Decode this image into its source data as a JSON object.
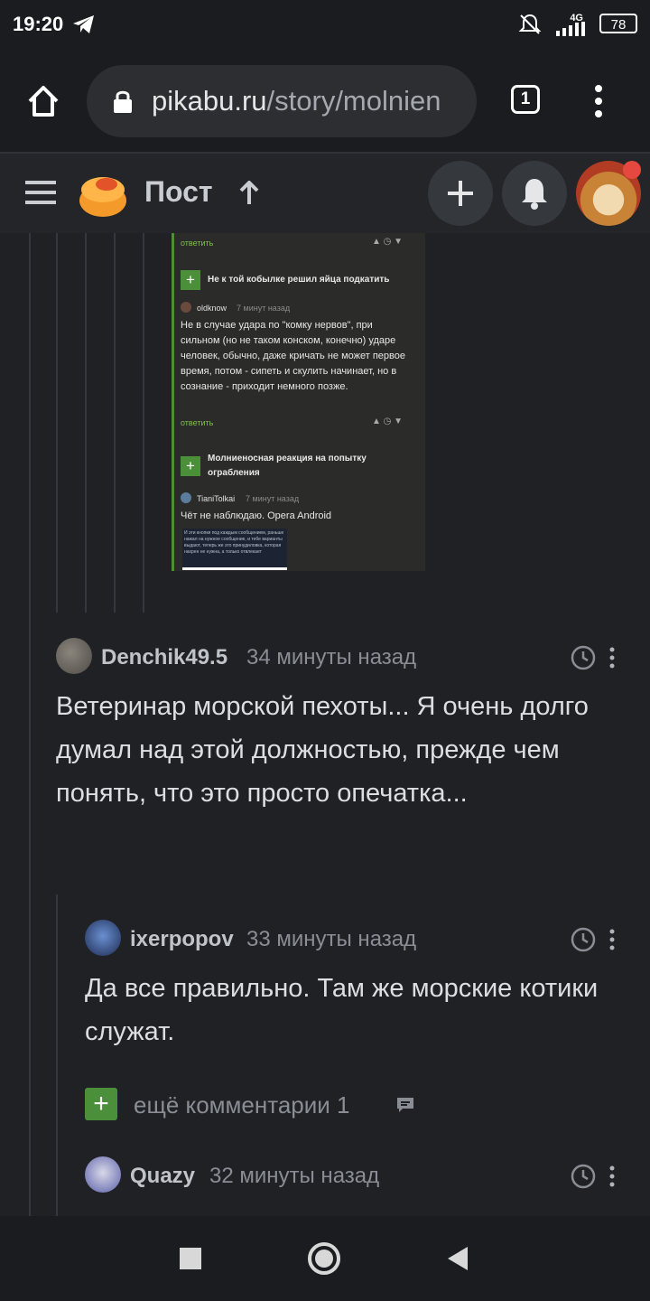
{
  "status": {
    "time": "19:20",
    "network": "4G",
    "battery": "78"
  },
  "browser": {
    "domain": "pikabu.ru",
    "path": "/story/molnien",
    "tab_count": "1"
  },
  "header": {
    "title": "Пост"
  },
  "embedded": {
    "reply1": "ответить",
    "c1_title": "Не к той кобылке решил яйца подкатить",
    "c1_user": "oldknow",
    "c1_time": "7 минут назад",
    "c1_body": "Не в случае удара по \"комку нервов\", при сильном (но не таком конском, конечно) ударе человек, обычно, даже кричать не может первое время, потом - сипеть и скулить начинает, но в сознание - приходит немного позже.",
    "reply2": "ответить",
    "c2_title": "Молниеносная реакция на попытку ограбления",
    "c2_user": "TianiTolkai",
    "c2_time": "7 минут назад",
    "c2_body": "Чёт не наблюдаю. Opera Android",
    "c2_inner": "И эти кнопки под каждым сообщением, раньше нажал на нужное сообщение, и тебе варианты выдают, теперь же это принудиловка, которая нахрен не нужна, а только отвлекает"
  },
  "comments": [
    {
      "user": "Denchik49.5",
      "time": "34 минуты назад",
      "text": "Ветеринар морской пехоты... Я очень долго думал над этой должностью, прежде чем понять, что это просто опечатка..."
    },
    {
      "user": "ixerpopov",
      "time": "33 минуты назад",
      "text": "Да все правильно. Там же морские котики служат."
    },
    {
      "user": "Quazy",
      "time": "32 минуты назад",
      "text": ""
    }
  ],
  "more_comments": {
    "label": "ещё комментарии 1"
  },
  "icons": [
    "telegram-icon",
    "mute-icon",
    "signal-icon",
    "lock-icon",
    "home-icon",
    "menu-icon",
    "more-vert-icon",
    "hamburger-icon",
    "logo-icon",
    "arrow-up-icon",
    "plus-icon",
    "bell-icon",
    "clock-icon",
    "chat-icon",
    "square-icon",
    "circle-icon",
    "back-icon"
  ],
  "colors": {
    "accent_green": "#4b8f3a",
    "notify_red": "#e5483f",
    "logo_orange": "#f39a2b"
  }
}
